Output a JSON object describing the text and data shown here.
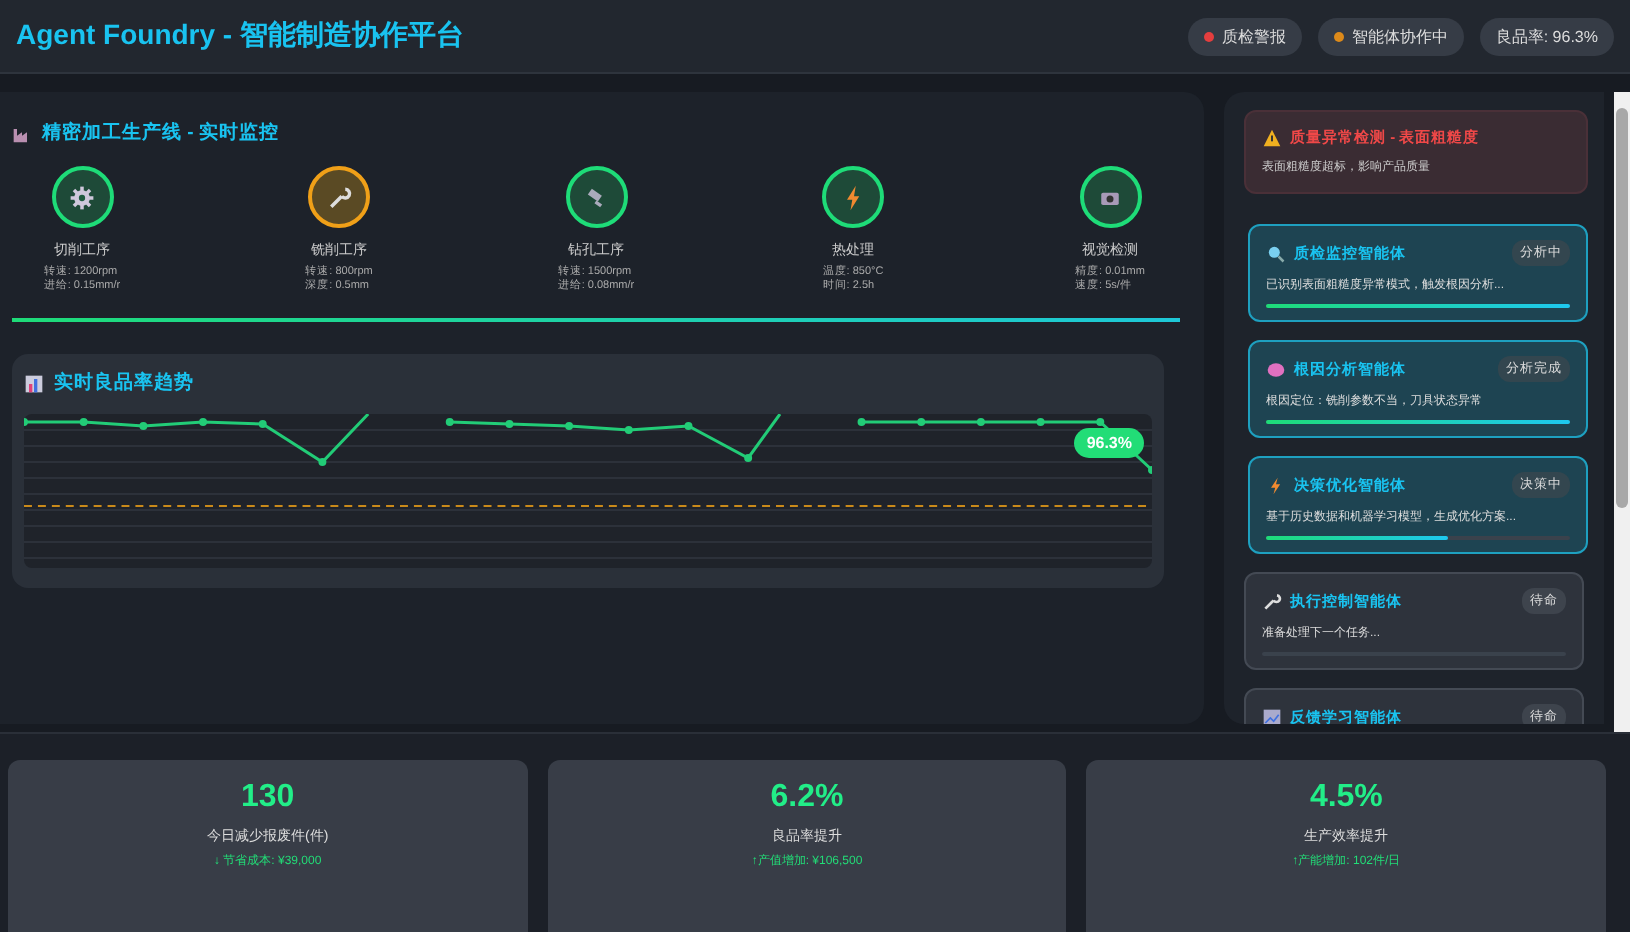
{
  "header": {
    "title": "Agent Foundry - 智能制造协作平台",
    "badges": [
      {
        "label": "质检警报",
        "color": "#e53e3e"
      },
      {
        "label": "智能体协作中",
        "color": "#dd8a1a"
      },
      {
        "label": "良品率: 96.3%"
      }
    ]
  },
  "production_line": {
    "title": "精密加工生产线 - 实时监控",
    "stations": [
      {
        "name": "切削工序",
        "params": [
          "转速: 1200rpm",
          "进给: 0.15mm/r"
        ],
        "warning": false
      },
      {
        "name": "铣削工序",
        "params": [
          "转速: 800rpm",
          "深度: 0.5mm"
        ],
        "warning": true
      },
      {
        "name": "钻孔工序",
        "params": [
          "转速: 1500rpm",
          "进给: 0.08mm/r"
        ],
        "warning": false
      },
      {
        "name": "热处理",
        "params": [
          "温度: 850°C",
          "时间: 2.5h"
        ],
        "warning": false
      },
      {
        "name": "视觉检测",
        "params": [
          "精度: 0.01mm",
          "速度: 5s/件"
        ],
        "warning": false
      }
    ]
  },
  "trend": {
    "title": "实时良品率趋势",
    "current_label": "96.3%"
  },
  "alert": {
    "title": "质量异常检测 - 表面粗糙度",
    "message": "表面粗糙度超标，影响产品质量"
  },
  "agents": [
    {
      "name": "质检监控智能体",
      "status": "分析中",
      "message": "已识别表面粗糙度异常模式，触发根因分析...",
      "level": 1,
      "active": true
    },
    {
      "name": "根因分析智能体",
      "status": "分析完成",
      "message": "根因定位：铣削参数不当，刀具状态异常",
      "level": 1,
      "active": true
    },
    {
      "name": "决策优化智能体",
      "status": "决策中",
      "message": "基于历史数据和机器学习模型，生成优化方案...",
      "level": 0.6,
      "active": true
    },
    {
      "name": "执行控制智能体",
      "status": "待命",
      "message": "准备处理下一个任务...",
      "active": false
    },
    {
      "name": "反馈学习智能体",
      "status": "待命",
      "active": false
    }
  ],
  "stats": [
    {
      "value": "130",
      "label": "今日减少报废件(件)",
      "detail": "↓ 节省成本: ¥39,000"
    },
    {
      "value": "6.2%",
      "label": "良品率提升",
      "detail": "↑产值增加: ¥106,500"
    },
    {
      "value": "4.5%",
      "label": "生产效率提升",
      "detail": "↑产能增加: 102件/日"
    }
  ]
}
